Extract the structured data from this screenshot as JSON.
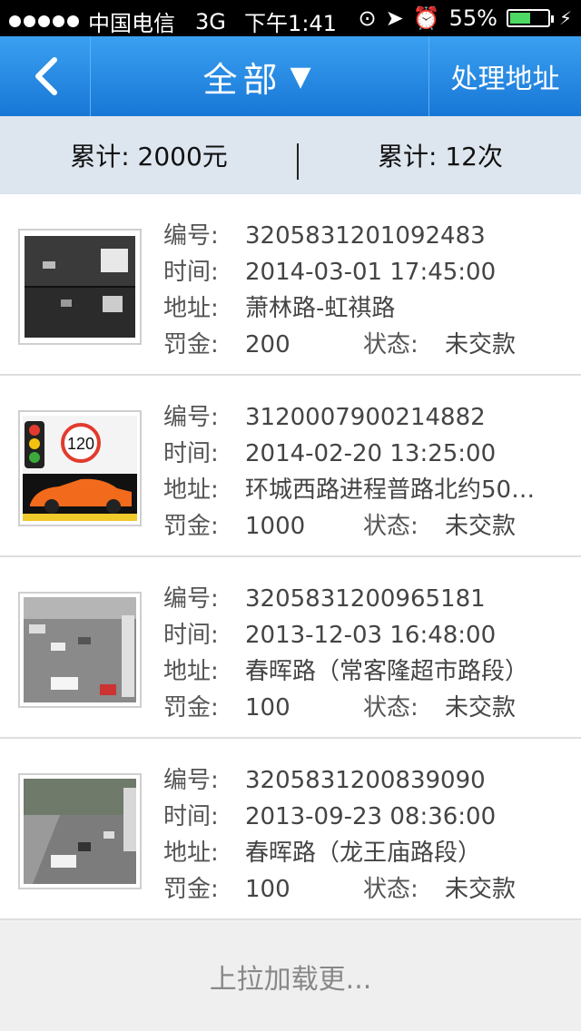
{
  "status_bar": {
    "carrier": "中国电信",
    "network": "3G",
    "time": "下午1:41",
    "battery": "55%",
    "battery_level": 0.55
  },
  "nav": {
    "title": "全部",
    "title_caret": "▼",
    "right_action": "处理地址",
    "back_icon": "chevron-left-icon"
  },
  "summary": {
    "total_amount": "累计: 2000元",
    "total_count": "累计: 12次"
  },
  "labels": {
    "number": "编号:",
    "time": "时间:",
    "address": "地址:",
    "fine": "罚金:",
    "status": "状态:"
  },
  "records": [
    {
      "number": "3205831201092483",
      "time": "2014-03-01 17:45:00",
      "address": "萧林路-虹祺路",
      "fine": "200",
      "status": "未交款",
      "thumb": "camera-photo"
    },
    {
      "number": "3120007900214882",
      "time": "2014-02-20 13:25:00",
      "address": "环城西路进程普路北约50…",
      "fine": "1000",
      "status": "未交款",
      "thumb": "speed-limit-icon"
    },
    {
      "number": "3205831200965181",
      "time": "2013-12-03 16:48:00",
      "address": "春晖路（常客隆超市路段）",
      "fine": "100",
      "status": "未交款",
      "thumb": "camera-photo"
    },
    {
      "number": "3205831200839090",
      "time": "2013-09-23 08:36:00",
      "address": "春晖路（龙王庙路段）",
      "fine": "100",
      "status": "未交款",
      "thumb": "camera-photo"
    }
  ],
  "load_more": "上拉加载更..."
}
